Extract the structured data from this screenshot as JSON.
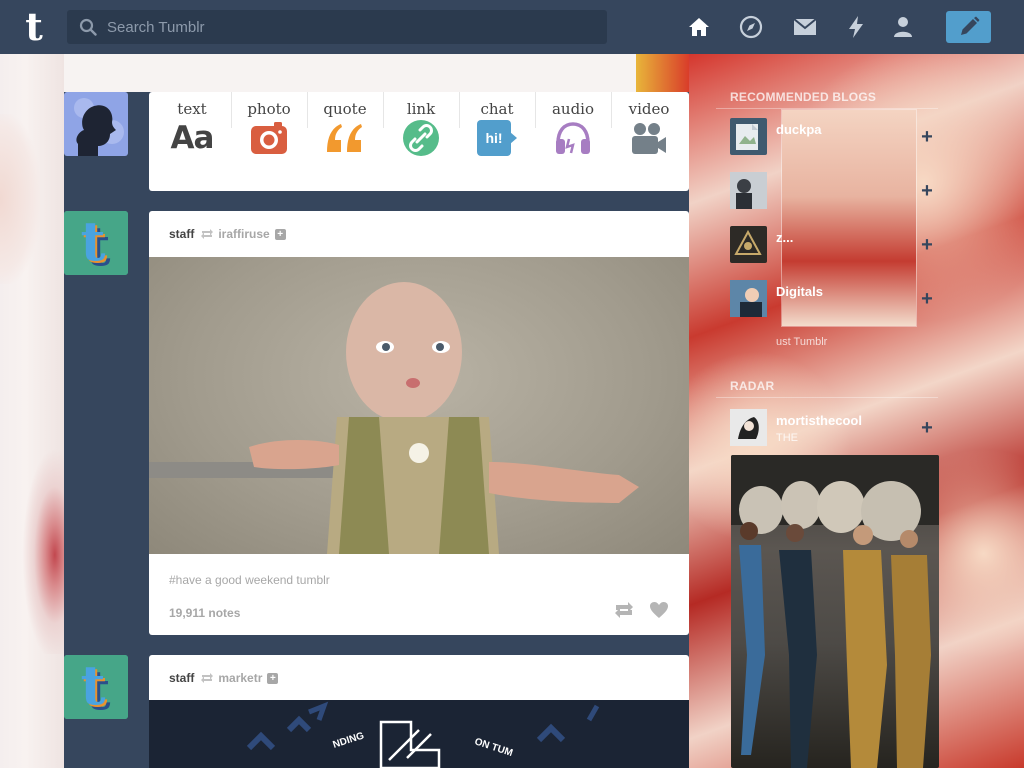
{
  "nav": {
    "search_placeholder": "Search Tumblr",
    "icons": [
      "home-icon",
      "explore-icon",
      "inbox-icon",
      "activity-icon",
      "account-icon",
      "compose-icon"
    ],
    "accent": "#529ecc",
    "background": "#36465d"
  },
  "post_types": [
    {
      "label": "text",
      "icon": "text-icon",
      "color": "#444444"
    },
    {
      "label": "photo",
      "icon": "camera-icon",
      "color": "#d95e40"
    },
    {
      "label": "quote",
      "icon": "quote-icon",
      "color": "#f2992e"
    },
    {
      "label": "link",
      "icon": "link-icon",
      "color": "#56bc8a"
    },
    {
      "label": "chat",
      "icon": "chat-icon",
      "color": "#529ecc"
    },
    {
      "label": "audio",
      "icon": "headphones-icon",
      "color": "#a77dc2"
    },
    {
      "label": "video",
      "icon": "video-camera-icon",
      "color": "#748089"
    }
  ],
  "text_icon_glyph": "Aa",
  "chat_icon_glyph": "hi!",
  "posts": [
    {
      "author": "staff",
      "source": "iraffiruse",
      "tags": "#have a good weekend tumblr",
      "notes": "19,911 notes"
    },
    {
      "author": "staff",
      "source": "marketr"
    }
  ],
  "post2_image_text": [
    "NDING",
    "ON TUM"
  ],
  "sidebar": {
    "recommended_header": "RECOMMENDED BLOGS",
    "recommended": [
      {
        "name": "duckpa"
      },
      {
        "name": ""
      },
      {
        "name": "z..."
      },
      {
        "name": "Digitals"
      }
    ],
    "explore_link": "ust Tumblr",
    "radar_header": "RADAR",
    "radar_name": "mortisthecool",
    "radar_sub": "THE"
  },
  "logo_letter": "t"
}
